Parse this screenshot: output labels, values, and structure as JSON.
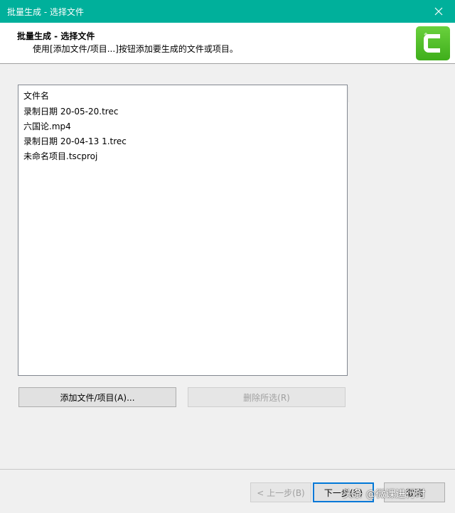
{
  "window": {
    "title": "批量生成 - 选择文件"
  },
  "header": {
    "title": "批量生成 - 选择文件",
    "subtitle": "使用[添加文件/项目...]按钮添加要生成的文件或项目。",
    "logo_icon": "camtasia-logo-icon",
    "logo_color": "#4dbf26"
  },
  "filelist": {
    "column_header": "文件名",
    "items": [
      {
        "name": "录制日期 20-05-20.trec"
      },
      {
        "name": "六国论.mp4"
      },
      {
        "name": "录制日期 20-04-13 1.trec"
      },
      {
        "name": "未命名项目.tscproj"
      }
    ]
  },
  "buttons": {
    "add": "添加文件/项目(A)...",
    "remove": "删除所选(R)",
    "back": "< 上一步(B)",
    "next": "下一步(N)",
    "cancel": "取消"
  },
  "watermark": "头条 @微课进行时",
  "colors": {
    "titlebar": "#00b09b",
    "accent": "#0078d7"
  }
}
